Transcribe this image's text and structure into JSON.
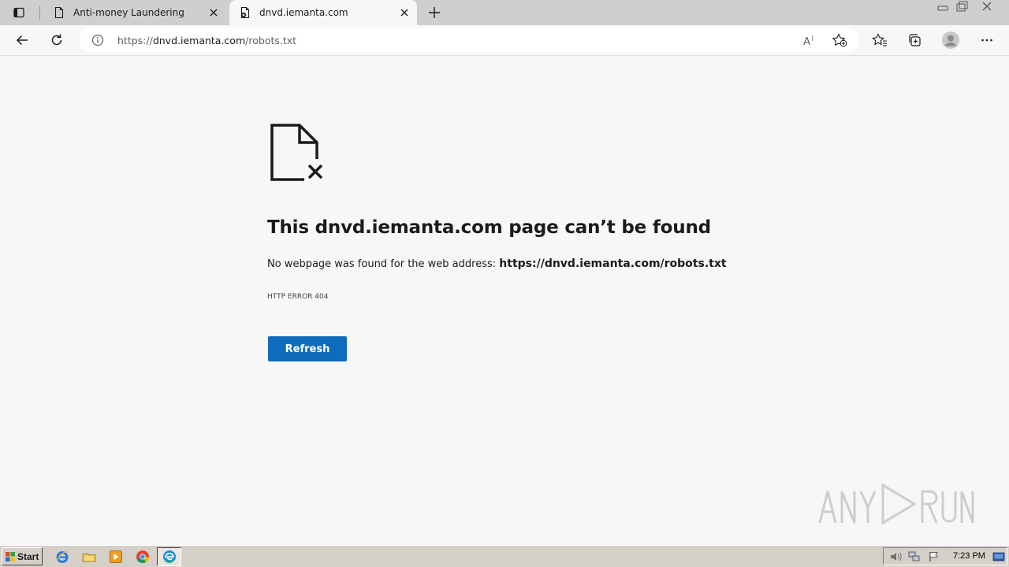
{
  "browser": {
    "tabs": [
      {
        "title": "Anti-money Laundering",
        "active": false
      },
      {
        "title": "dnvd.iemanta.com",
        "active": true
      }
    ],
    "address_bar": {
      "url_prefix": "https://",
      "url_host": "dnvd.iemanta.com",
      "url_path": "/robots.txt"
    }
  },
  "error_page": {
    "title": "This dnvd.iemanta.com page can’t be found",
    "message": "No webpage was found for the web address:",
    "message_url": "https://dnvd.iemanta.com/robots.txt",
    "error_code": "HTTP ERROR 404",
    "refresh_label": "Refresh"
  },
  "watermark": {
    "text": "ANY RUN"
  },
  "taskbar": {
    "start_label": "Start",
    "clock": "7:23 PM"
  },
  "colors": {
    "accent": "#0f6cbd",
    "page_bg": "#f7f7f7",
    "tabstrip_bg": "#cfcfcf",
    "taskbar_bg": "#d4d0c8"
  }
}
